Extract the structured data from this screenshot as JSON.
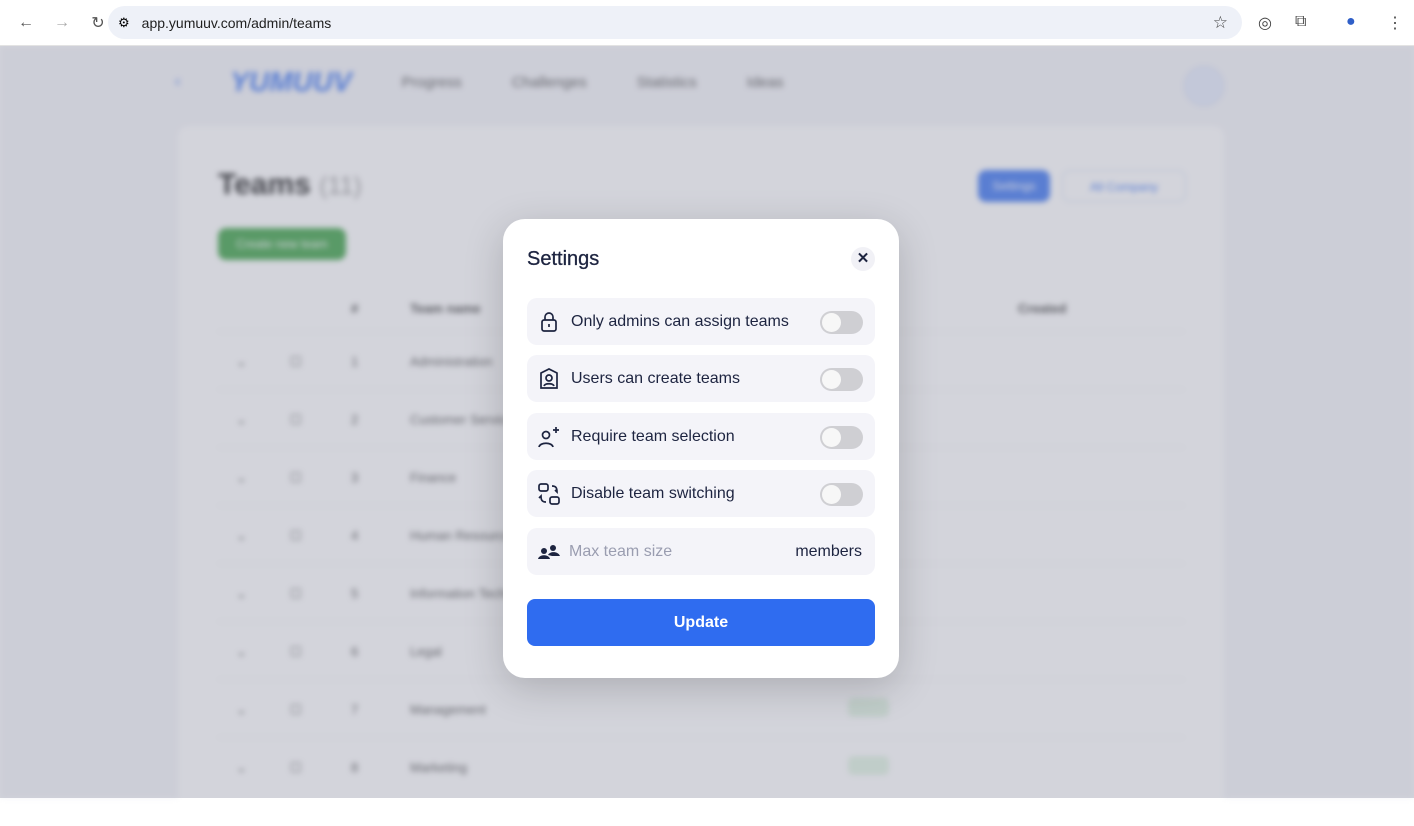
{
  "browser": {
    "url": "app.yumuuv.com/admin/teams"
  },
  "app": {
    "logo": "YUMUUV",
    "nav": [
      "Progress",
      "Challenges",
      "Statistics",
      "Ideas"
    ]
  },
  "page": {
    "title": "Teams",
    "count": "(11)",
    "settings_btn": "Settings",
    "company_select": "All Company",
    "create_btn": "Create new team",
    "headers": {
      "num": "#",
      "name": "Team name",
      "created": "Created"
    },
    "rows": [
      {
        "n": "1",
        "name": "Administration"
      },
      {
        "n": "2",
        "name": "Customer Service"
      },
      {
        "n": "3",
        "name": "Finance"
      },
      {
        "n": "4",
        "name": "Human Resources"
      },
      {
        "n": "5",
        "name": "Information Technology"
      },
      {
        "n": "6",
        "name": "Legal"
      },
      {
        "n": "7",
        "name": "Management"
      },
      {
        "n": "8",
        "name": "Marketing"
      }
    ]
  },
  "modal": {
    "title": "Settings",
    "options": [
      {
        "label": "Only admins can assign teams",
        "icon": "lock-icon",
        "on": false
      },
      {
        "label": "Users can create teams",
        "icon": "user-badge-icon",
        "on": false
      },
      {
        "label": "Require team selection",
        "icon": "user-plus-icon",
        "on": false
      },
      {
        "label": "Disable team switching",
        "icon": "switch-icon",
        "on": false
      }
    ],
    "max_size": {
      "placeholder": "Max team size",
      "value": "",
      "unit": "members"
    },
    "update": "Update"
  },
  "colors": {
    "primary": "#2f6cf0",
    "green": "#2e9b37"
  }
}
